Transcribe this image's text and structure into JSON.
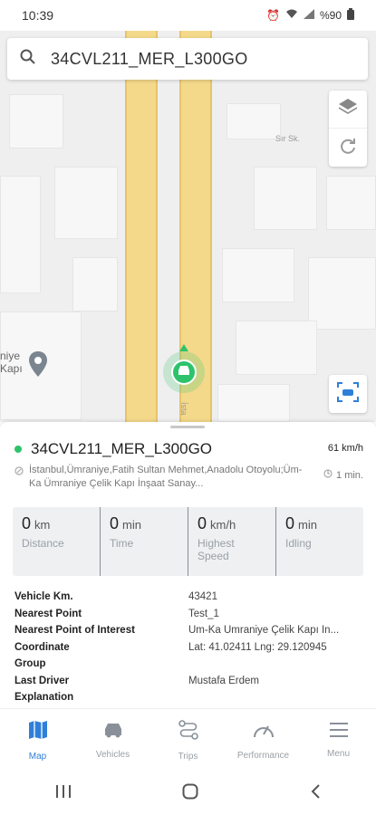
{
  "status": {
    "time": "10:39",
    "battery": "%90"
  },
  "search": {
    "value": "34CVL211_MER_L300GO"
  },
  "map": {
    "street_label": "Sır Sk.",
    "road_label": "İsta",
    "poi_label": "niye\nKapı"
  },
  "vehicle": {
    "name": "34CVL211_MER_L300GO",
    "speed": "61 km/h",
    "address": "İstanbul,Ümraniye,Fatih Sultan Mehmet,Anadolu Otoyolu;Üm-Ka Ümraniye Çelik Kapı İnşaat Sanay...",
    "since": "1 min."
  },
  "stats": [
    {
      "value": "0",
      "unit": "km",
      "label": "Distance"
    },
    {
      "value": "0",
      "unit": "min",
      "label": "Time"
    },
    {
      "value": "0",
      "unit": "km/h",
      "label": "Highest Speed"
    },
    {
      "value": "0",
      "unit": "min",
      "label": "Idling"
    }
  ],
  "info": [
    {
      "key": "Vehicle Km.",
      "value": "43421"
    },
    {
      "key": "Nearest Point",
      "value": "Test_1"
    },
    {
      "key": "Nearest Point of Interest",
      "value": "Üm-Ka Ümraniye Çelik Kapı İn..."
    },
    {
      "key": "Coordinate",
      "value": "Lat: 41.02411 Lng: 29.120945"
    },
    {
      "key": "Group",
      "value": ""
    },
    {
      "key": "Last Driver",
      "value": "Mustafa Erdem"
    },
    {
      "key": "Explanation",
      "value": ""
    }
  ],
  "nav": [
    {
      "label": "Map",
      "icon": "map-icon"
    },
    {
      "label": "Vehicles",
      "icon": "car-icon"
    },
    {
      "label": "Trips",
      "icon": "route-icon"
    },
    {
      "label": "Performance",
      "icon": "gauge-icon"
    },
    {
      "label": "Menu",
      "icon": "menu-icon"
    }
  ],
  "colors": {
    "accent": "#2f7fd9",
    "online": "#2ec36b",
    "road": "#f4d98a"
  }
}
